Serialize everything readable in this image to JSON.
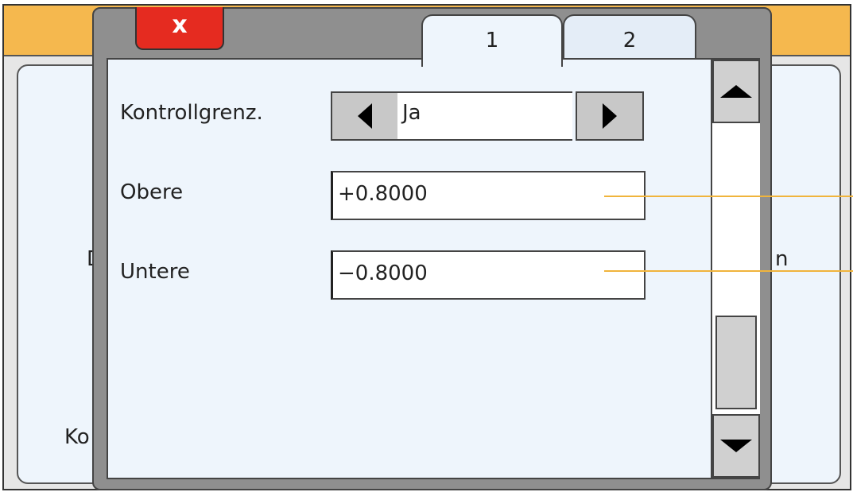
{
  "background": {
    "partial_left_text": "D",
    "partial_right_text": "n",
    "partial_bottom_text": "Ko"
  },
  "dialog": {
    "close_label": "x",
    "tabs": [
      {
        "label": "1",
        "active": true
      },
      {
        "label": "2",
        "active": false
      }
    ],
    "fields": {
      "control_limits": {
        "label": "Kontrollgrenz.",
        "value": "Ja"
      },
      "upper": {
        "label": "Obere",
        "value": "+0.8000"
      },
      "lower": {
        "label": "Untere",
        "value": "−0.8000"
      }
    }
  },
  "icons": {
    "prev": "triangle-left-icon",
    "next": "triangle-right-icon",
    "scroll_up": "triangle-up-icon",
    "scroll_down": "triangle-down-icon"
  },
  "colors": {
    "accent_orange": "#f5b84e",
    "close_red": "#e52b20",
    "panel_bg": "#eef5fc",
    "lead_line": "#f0b43c"
  }
}
